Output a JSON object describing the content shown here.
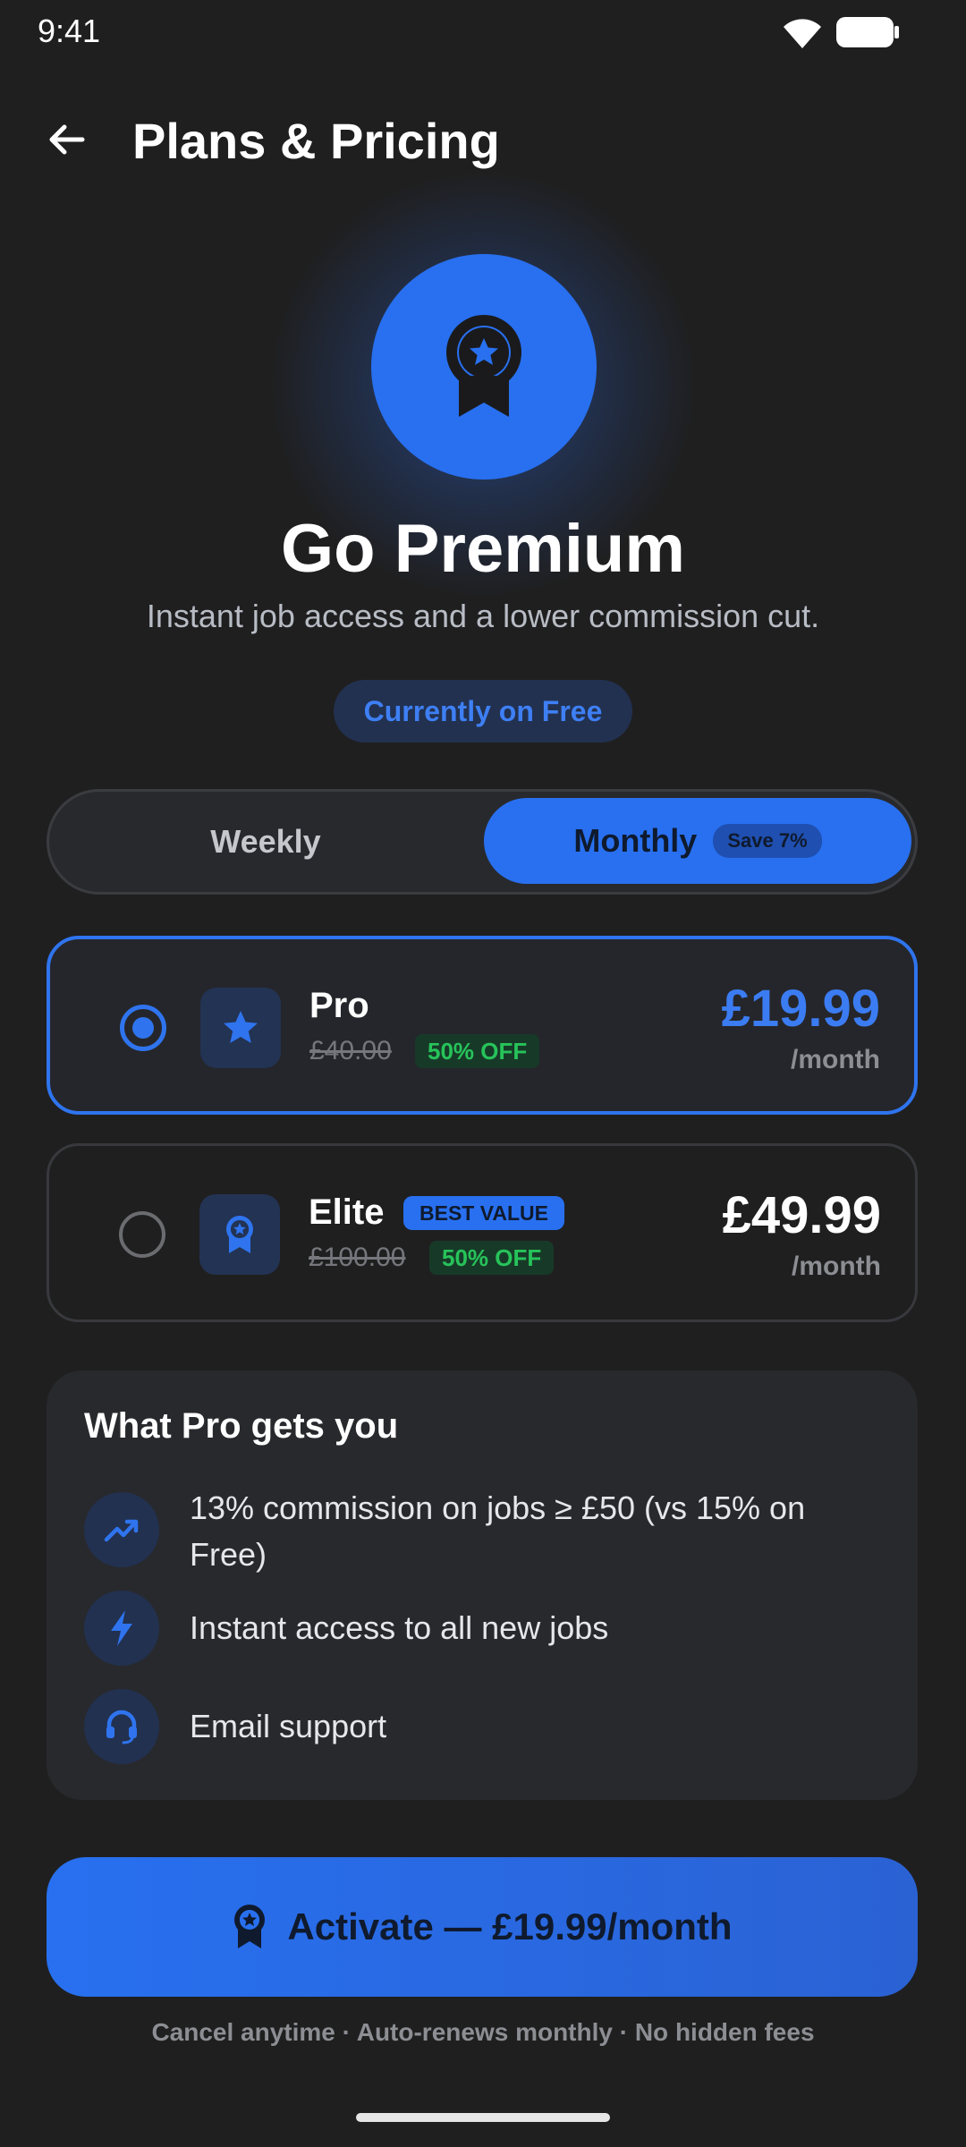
{
  "status_bar": {
    "time": "9:41"
  },
  "header": {
    "title": "Plans & Pricing"
  },
  "hero": {
    "title": "Go Premium",
    "subtitle": "Instant job access and a lower commission cut.",
    "current_plan": "Currently on Free"
  },
  "billing_toggle": {
    "weekly_label": "Weekly",
    "monthly_label": "Monthly",
    "monthly_badge": "Save 7%",
    "selected": "Monthly"
  },
  "plans": [
    {
      "name": "Pro",
      "price": "£19.99",
      "period": "/month",
      "was": "£40.00",
      "discount": "50% OFF",
      "badge": "",
      "selected": true
    },
    {
      "name": "Elite",
      "price": "£49.99",
      "period": "/month",
      "was": "£100.00",
      "discount": "50% OFF",
      "badge": "BEST VALUE",
      "selected": false
    }
  ],
  "features": {
    "title": "What Pro gets you",
    "items": [
      {
        "icon": "trending-up-icon",
        "text": "13% commission on jobs ≥ £50 (vs 15% on Free)"
      },
      {
        "icon": "lightning-icon",
        "text": "Instant access to all new jobs"
      },
      {
        "icon": "headset-icon",
        "text": "Email support"
      }
    ]
  },
  "cta": {
    "label": "Activate — £19.99/month"
  },
  "footnote": "Cancel anytime · Auto-renews monthly · No hidden fees",
  "colors": {
    "accent": "#2870f0",
    "background": "#1f1f20",
    "card": "#28292d",
    "success": "#27c35a"
  }
}
